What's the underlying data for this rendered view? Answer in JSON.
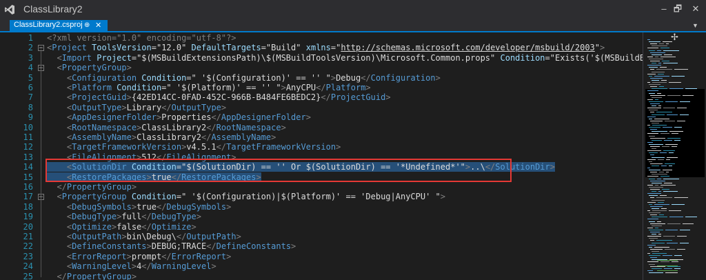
{
  "window": {
    "title": "ClassLibrary2",
    "buttons": [
      "–",
      "🗗",
      "✕"
    ]
  },
  "tab": {
    "label": "ClassLibrary2.csproj",
    "pin_glyph": "⊕",
    "close_glyph": "✕",
    "dropdown_glyph": "▼"
  },
  "editor": {
    "selected_lines": [
      14,
      15
    ],
    "lines": [
      {
        "n": "1",
        "fold": "",
        "parts": [
          [
            "tb",
            "<?xml version=\"1.0\" encoding=\"utf-8\"?>"
          ]
        ]
      },
      {
        "n": "2",
        "fold": "−",
        "parts": [
          [
            "tb",
            "<"
          ],
          [
            "tn",
            "Project"
          ],
          [
            "an",
            " ToolsVersion"
          ],
          [
            "at",
            "=\""
          ],
          [
            "av",
            "12.0"
          ],
          [
            "at",
            "\""
          ],
          [
            "an",
            " DefaultTargets"
          ],
          [
            "at",
            "=\""
          ],
          [
            "av",
            "Build"
          ],
          [
            "at",
            "\""
          ],
          [
            "an",
            " xmlns"
          ],
          [
            "at",
            "=\""
          ],
          [
            "lk",
            "http://schemas.microsoft.com/developer/msbuild/2003"
          ],
          [
            "at",
            "\""
          ],
          [
            "tb",
            ">"
          ]
        ]
      },
      {
        "n": "3",
        "fold": "",
        "parts": [
          [
            "tb",
            "  <"
          ],
          [
            "tn",
            "Import"
          ],
          [
            "an",
            " Project"
          ],
          [
            "at",
            "=\""
          ],
          [
            "av",
            "$(MSBuildExtensionsPath)\\$(MSBuildToolsVersion)\\Microsoft.Common.props"
          ],
          [
            "at",
            "\""
          ],
          [
            "an",
            " Condition"
          ],
          [
            "at",
            "=\""
          ],
          [
            "av",
            "Exists('$(MSBuildExtensionsPath)\\$"
          ]
        ]
      },
      {
        "n": "4",
        "fold": "−",
        "parts": [
          [
            "tb",
            "  <"
          ],
          [
            "tn",
            "PropertyGroup"
          ],
          [
            "tb",
            ">"
          ]
        ]
      },
      {
        "n": "5",
        "fold": "",
        "parts": [
          [
            "tb",
            "    <"
          ],
          [
            "tn",
            "Configuration"
          ],
          [
            "an",
            " Condition"
          ],
          [
            "at",
            "=\""
          ],
          [
            "av",
            " '$(Configuration)' == '' "
          ],
          [
            "at",
            "\""
          ],
          [
            "tb",
            ">"
          ],
          [
            "av",
            "Debug"
          ],
          [
            "tb",
            "</"
          ],
          [
            "tn",
            "Configuration"
          ],
          [
            "tb",
            ">"
          ]
        ]
      },
      {
        "n": "6",
        "fold": "",
        "parts": [
          [
            "tb",
            "    <"
          ],
          [
            "tn",
            "Platform"
          ],
          [
            "an",
            " Condition"
          ],
          [
            "at",
            "=\""
          ],
          [
            "av",
            " '$(Platform)' == '' "
          ],
          [
            "at",
            "\""
          ],
          [
            "tb",
            ">"
          ],
          [
            "av",
            "AnyCPU"
          ],
          [
            "tb",
            "</"
          ],
          [
            "tn",
            "Platform"
          ],
          [
            "tb",
            ">"
          ]
        ]
      },
      {
        "n": "7",
        "fold": "",
        "parts": [
          [
            "tb",
            "    <"
          ],
          [
            "tn",
            "ProjectGuid"
          ],
          [
            "tb",
            ">"
          ],
          [
            "av",
            "{42ED14CC-0FAD-452C-966B-B484FE6BEDC2}"
          ],
          [
            "tb",
            "</"
          ],
          [
            "tn",
            "ProjectGuid"
          ],
          [
            "tb",
            ">"
          ]
        ]
      },
      {
        "n": "8",
        "fold": "",
        "parts": [
          [
            "tb",
            "    <"
          ],
          [
            "tn",
            "OutputType"
          ],
          [
            "tb",
            ">"
          ],
          [
            "av",
            "Library"
          ],
          [
            "tb",
            "</"
          ],
          [
            "tn",
            "OutputType"
          ],
          [
            "tb",
            ">"
          ]
        ]
      },
      {
        "n": "9",
        "fold": "",
        "parts": [
          [
            "tb",
            "    <"
          ],
          [
            "tn",
            "AppDesignerFolder"
          ],
          [
            "tb",
            ">"
          ],
          [
            "av",
            "Properties"
          ],
          [
            "tb",
            "</"
          ],
          [
            "tn",
            "AppDesignerFolder"
          ],
          [
            "tb",
            ">"
          ]
        ]
      },
      {
        "n": "10",
        "fold": "",
        "parts": [
          [
            "tb",
            "    <"
          ],
          [
            "tn",
            "RootNamespace"
          ],
          [
            "tb",
            ">"
          ],
          [
            "av",
            "ClassLibrary2"
          ],
          [
            "tb",
            "</"
          ],
          [
            "tn",
            "RootNamespace"
          ],
          [
            "tb",
            ">"
          ]
        ]
      },
      {
        "n": "11",
        "fold": "",
        "parts": [
          [
            "tb",
            "    <"
          ],
          [
            "tn",
            "AssemblyName"
          ],
          [
            "tb",
            ">"
          ],
          [
            "av",
            "ClassLibrary2"
          ],
          [
            "tb",
            "</"
          ],
          [
            "tn",
            "AssemblyName"
          ],
          [
            "tb",
            ">"
          ]
        ]
      },
      {
        "n": "12",
        "fold": "",
        "parts": [
          [
            "tb",
            "    <"
          ],
          [
            "tn",
            "TargetFrameworkVersion"
          ],
          [
            "tb",
            ">"
          ],
          [
            "av",
            "v4.5.1"
          ],
          [
            "tb",
            "</"
          ],
          [
            "tn",
            "TargetFrameworkVersion"
          ],
          [
            "tb",
            ">"
          ]
        ]
      },
      {
        "n": "13",
        "fold": "",
        "parts": [
          [
            "tb",
            "    <"
          ],
          [
            "tn",
            "FileAlignment"
          ],
          [
            "tb",
            ">"
          ],
          [
            "av",
            "512"
          ],
          [
            "tb",
            "</"
          ],
          [
            "tn",
            "FileAlignment"
          ],
          [
            "tb",
            ">"
          ]
        ]
      },
      {
        "n": "14",
        "fold": "",
        "parts": [
          [
            "tb",
            "    <"
          ],
          [
            "tn",
            "SolutionDir"
          ],
          [
            "an",
            " Condition"
          ],
          [
            "at",
            "=\""
          ],
          [
            "av",
            "$(SolutionDir) == '' Or $(SolutionDir) == '*Undefined*'"
          ],
          [
            "at",
            "\""
          ],
          [
            "tb",
            ">"
          ],
          [
            "av",
            "..\\"
          ],
          [
            "tb",
            "</"
          ],
          [
            "tn",
            "SolutionDir"
          ],
          [
            "tb",
            ">"
          ]
        ]
      },
      {
        "n": "15",
        "fold": "",
        "parts": [
          [
            "tb",
            "    <"
          ],
          [
            "tn",
            "RestorePackages"
          ],
          [
            "tb",
            ">"
          ],
          [
            "av",
            "true"
          ],
          [
            "tb",
            "</"
          ],
          [
            "tn",
            "RestorePackages"
          ],
          [
            "tb",
            ">"
          ]
        ]
      },
      {
        "n": "16",
        "fold": "",
        "parts": [
          [
            "tb",
            "  </"
          ],
          [
            "tn",
            "PropertyGroup"
          ],
          [
            "tb",
            ">"
          ]
        ]
      },
      {
        "n": "17",
        "fold": "−",
        "parts": [
          [
            "tb",
            "  <"
          ],
          [
            "tn",
            "PropertyGroup"
          ],
          [
            "an",
            " Condition"
          ],
          [
            "at",
            "=\""
          ],
          [
            "av",
            " '$(Configuration)|$(Platform)' == 'Debug|AnyCPU' "
          ],
          [
            "at",
            "\""
          ],
          [
            "tb",
            ">"
          ]
        ]
      },
      {
        "n": "18",
        "fold": "",
        "parts": [
          [
            "tb",
            "    <"
          ],
          [
            "tn",
            "DebugSymbols"
          ],
          [
            "tb",
            ">"
          ],
          [
            "av",
            "true"
          ],
          [
            "tb",
            "</"
          ],
          [
            "tn",
            "DebugSymbols"
          ],
          [
            "tb",
            ">"
          ]
        ]
      },
      {
        "n": "19",
        "fold": "",
        "parts": [
          [
            "tb",
            "    <"
          ],
          [
            "tn",
            "DebugType"
          ],
          [
            "tb",
            ">"
          ],
          [
            "av",
            "full"
          ],
          [
            "tb",
            "</"
          ],
          [
            "tn",
            "DebugType"
          ],
          [
            "tb",
            ">"
          ]
        ]
      },
      {
        "n": "20",
        "fold": "",
        "parts": [
          [
            "tb",
            "    <"
          ],
          [
            "tn",
            "Optimize"
          ],
          [
            "tb",
            ">"
          ],
          [
            "av",
            "false"
          ],
          [
            "tb",
            "</"
          ],
          [
            "tn",
            "Optimize"
          ],
          [
            "tb",
            ">"
          ]
        ]
      },
      {
        "n": "21",
        "fold": "",
        "parts": [
          [
            "tb",
            "    <"
          ],
          [
            "tn",
            "OutputPath"
          ],
          [
            "tb",
            ">"
          ],
          [
            "av",
            "bin\\Debug\\"
          ],
          [
            "tb",
            "</"
          ],
          [
            "tn",
            "OutputPath"
          ],
          [
            "tb",
            ">"
          ]
        ]
      },
      {
        "n": "22",
        "fold": "",
        "parts": [
          [
            "tb",
            "    <"
          ],
          [
            "tn",
            "DefineConstants"
          ],
          [
            "tb",
            ">"
          ],
          [
            "av",
            "DEBUG;TRACE"
          ],
          [
            "tb",
            "</"
          ],
          [
            "tn",
            "DefineConstants"
          ],
          [
            "tb",
            ">"
          ]
        ]
      },
      {
        "n": "23",
        "fold": "",
        "parts": [
          [
            "tb",
            "    <"
          ],
          [
            "tn",
            "ErrorReport"
          ],
          [
            "tb",
            ">"
          ],
          [
            "av",
            "prompt"
          ],
          [
            "tb",
            "</"
          ],
          [
            "tn",
            "ErrorReport"
          ],
          [
            "tb",
            ">"
          ]
        ]
      },
      {
        "n": "24",
        "fold": "",
        "parts": [
          [
            "tb",
            "    <"
          ],
          [
            "tn",
            "WarningLevel"
          ],
          [
            "tb",
            ">"
          ],
          [
            "av",
            "4"
          ],
          [
            "tb",
            "</"
          ],
          [
            "tn",
            "WarningLevel"
          ],
          [
            "tb",
            ">"
          ]
        ]
      },
      {
        "n": "25",
        "fold": "",
        "parts": [
          [
            "tb",
            "  </"
          ],
          [
            "tn",
            "PropertyGroup"
          ],
          [
            "tb",
            ">"
          ]
        ]
      }
    ]
  },
  "minimap": {
    "split_glyph": "✢"
  },
  "colors": {
    "accent": "#007acc",
    "highlight_border": "#e53935",
    "selection": "#264f78",
    "line_number": "#2b91af"
  }
}
